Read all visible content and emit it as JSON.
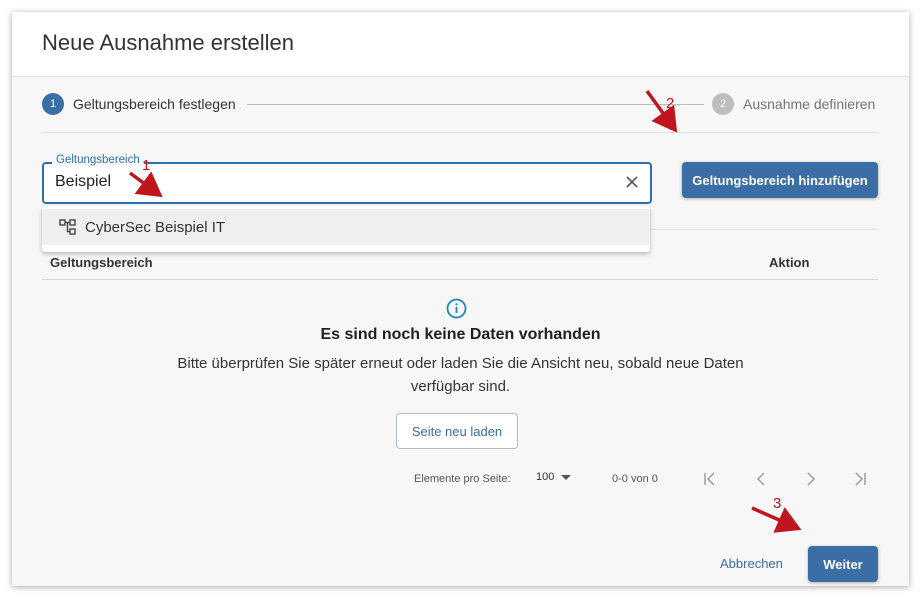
{
  "dialog": {
    "title": "Neue Ausnahme erstellen"
  },
  "stepper": {
    "steps": [
      {
        "number": "1",
        "label": "Geltungsbereich festlegen",
        "state": "active"
      },
      {
        "number": "2",
        "label": "Ausnahme definieren",
        "state": "inactive"
      }
    ]
  },
  "scope_field": {
    "label": "Geltungsbereich",
    "value": "Beispiel"
  },
  "add_button": {
    "label": "Geltungsbereich hinzufügen"
  },
  "dropdown": {
    "options": [
      {
        "icon": "hierarchy-icon",
        "label": "CyberSec Beispiel IT"
      }
    ]
  },
  "table": {
    "columns": [
      "Geltungsbereich",
      "Aktion"
    ]
  },
  "empty_state": {
    "icon": "info-icon",
    "title": "Es sind noch keine Daten vorhanden",
    "message": "Bitte überprüfen Sie später erneut oder laden Sie die Ansicht neu, sobald neue Daten verfügbar sind.",
    "reload_label": "Seite neu laden"
  },
  "pagination": {
    "per_page_label": "Elemente pro Seite:",
    "per_page_value": "100",
    "range": "0-0 von 0"
  },
  "footer": {
    "cancel_label": "Abbrechen",
    "next_label": "Weiter"
  },
  "annotations": [
    "1",
    "2",
    "3"
  ],
  "colors": {
    "primary": "#3a6ea5",
    "annotation": "#c0141e",
    "inactive_step": "#bdbdbd"
  }
}
